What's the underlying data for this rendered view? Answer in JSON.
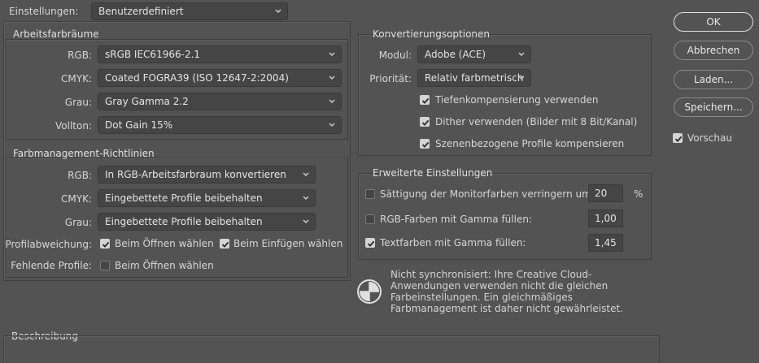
{
  "settings": {
    "label": "Einstellungen:",
    "value": "Benutzerdefiniert"
  },
  "workspaces": {
    "title": "Arbeitsfarbräume",
    "rgb": {
      "label": "RGB:",
      "value": "sRGB IEC61966-2.1"
    },
    "cmyk": {
      "label": "CMYK:",
      "value": "Coated FOGRA39 (ISO 12647-2:2004)"
    },
    "gray": {
      "label": "Grau:",
      "value": "Gray Gamma 2.2"
    },
    "spot": {
      "label": "Vollton:",
      "value": "Dot Gain 15%"
    }
  },
  "policies": {
    "title": "Farbmanagement-Richtlinien",
    "rgb": {
      "label": "RGB:",
      "value": "In RGB-Arbeitsfarbraum konvertieren"
    },
    "cmyk": {
      "label": "CMYK:",
      "value": "Eingebettete Profile beibehalten"
    },
    "gray": {
      "label": "Grau:",
      "value": "Eingebettete Profile beibehalten"
    },
    "mismatch": {
      "label": "Profilabweichung:",
      "open_label": "Beim Öffnen wählen",
      "open_checked": true,
      "paste_label": "Beim Einfügen wählen",
      "paste_checked": true
    },
    "missing": {
      "label": "Fehlende Profile:",
      "open_label": "Beim Öffnen wählen",
      "open_checked": false
    }
  },
  "conversion": {
    "title": "Konvertierungsoptionen",
    "engine": {
      "label": "Modul:",
      "value": "Adobe (ACE)"
    },
    "intent": {
      "label": "Priorität:",
      "value": "Relativ farbmetrisch"
    },
    "black_point": {
      "label": "Tiefenkompensierung verwenden",
      "checked": true
    },
    "dither": {
      "label": "Dither verwenden (Bilder mit 8 Bit/Kanal)",
      "checked": true
    },
    "scene": {
      "label": "Szenenbezogene Profile kompensieren",
      "checked": true
    }
  },
  "advanced": {
    "title": "Erweiterte Einstellungen",
    "desaturate": {
      "label": "Sättigung der Monitorfarben verringern um:",
      "checked": false,
      "value": "20",
      "unit": "%"
    },
    "blend_rgb": {
      "label": "RGB-Farben mit Gamma füllen:",
      "checked": false,
      "value": "1,00"
    },
    "blend_text": {
      "label": "Textfarben mit Gamma füllen:",
      "checked": true,
      "value": "1,45"
    }
  },
  "sync_note": "Nicht synchronisiert: Ihre Creative Cloud-Anwendungen verwenden nicht die gleichen Farbeinstellungen. Ein gleichmäßiges Farbmanagement ist daher nicht gewährleistet.",
  "description": {
    "title": "Beschreibung"
  },
  "buttons": {
    "ok": "OK",
    "cancel": "Abbrechen",
    "load": "Laden...",
    "save": "Speichern..."
  },
  "preview": {
    "label": "Vorschau",
    "checked": true
  }
}
